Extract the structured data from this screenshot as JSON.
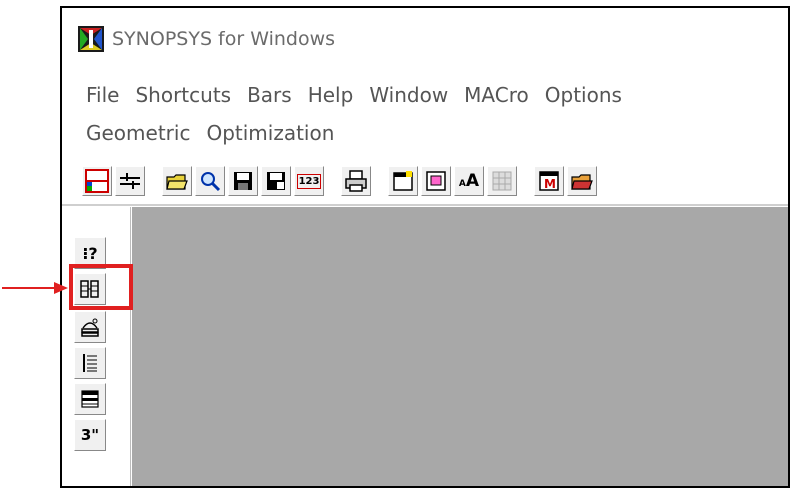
{
  "window": {
    "title": "SYNOPSYS for Windows",
    "icon": "synopsys-app-icon"
  },
  "menubar": {
    "row1": [
      "File",
      "Shortcuts",
      "Bars",
      "Help",
      "Window",
      "MACro",
      "Options"
    ],
    "row2": [
      "Geometric",
      "Optimization"
    ]
  },
  "toolbar": {
    "buttons": [
      {
        "name": "lens-layout-icon"
      },
      {
        "name": "adjust-icon"
      },
      {
        "name": "open-folder-icon"
      },
      {
        "name": "search-icon"
      },
      {
        "name": "save-icon"
      },
      {
        "name": "save-as-icon"
      },
      {
        "name": "numbers-icon",
        "label": "123"
      },
      {
        "name": "print-icon"
      },
      {
        "name": "new-window-icon"
      },
      {
        "name": "edit-window-icon"
      },
      {
        "name": "font-size-icon",
        "label": "AA"
      },
      {
        "name": "grid-disabled-icon"
      },
      {
        "name": "macro-icon",
        "label": "M"
      },
      {
        "name": "macro-folder-icon"
      }
    ]
  },
  "sidebar": {
    "buttons": [
      {
        "name": "help-icon",
        "label": "⁝?"
      },
      {
        "name": "grid-icon",
        "label": ""
      },
      {
        "name": "eject-icon",
        "label": ""
      },
      {
        "name": "list-icon",
        "label": ""
      },
      {
        "name": "table-icon",
        "label": ""
      },
      {
        "name": "three-inch-icon",
        "label": "3\""
      }
    ]
  },
  "annotation": {
    "highlight_color": "#e02020",
    "arrow_color": "#e02020",
    "target": "grid-icon"
  },
  "colors": {
    "workspace": "#a8a8a8",
    "title_text": "#6b6b6b",
    "menu_text": "#555555"
  }
}
